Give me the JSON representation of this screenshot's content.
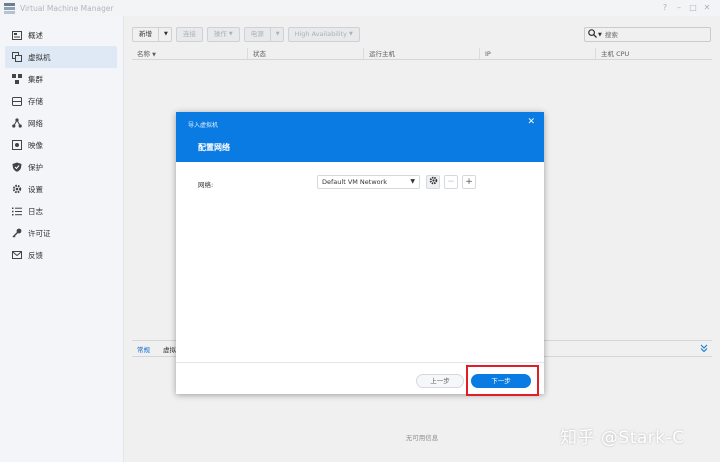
{
  "app": {
    "title": "Virtual Machine Manager"
  },
  "window_controls": [
    "?",
    "–",
    "□",
    "✕"
  ],
  "sidebar": {
    "items": [
      {
        "label": "概述",
        "icon": "overview-icon",
        "active": false
      },
      {
        "label": "虚拟机",
        "icon": "virtual-machine-icon",
        "active": true
      },
      {
        "label": "集群",
        "icon": "cluster-icon",
        "active": false
      },
      {
        "label": "存储",
        "icon": "storage-icon",
        "active": false
      },
      {
        "label": "网络",
        "icon": "network-icon",
        "active": false
      },
      {
        "label": "映像",
        "icon": "image-icon",
        "active": false
      },
      {
        "label": "保护",
        "icon": "shield-icon",
        "active": false
      },
      {
        "label": "设置",
        "icon": "gear-icon",
        "active": false
      },
      {
        "label": "日志",
        "icon": "list-icon",
        "active": false
      },
      {
        "label": "许可证",
        "icon": "key-icon",
        "active": false
      },
      {
        "label": "反馈",
        "icon": "mail-icon",
        "active": false
      }
    ]
  },
  "toolbar": {
    "new_label": "新增",
    "connect_label": "连接",
    "action_label": "操作",
    "power_label": "电源",
    "ha_label": "High Availability"
  },
  "search": {
    "placeholder": "搜索"
  },
  "table": {
    "columns": [
      "名称",
      "状态",
      "运行主机",
      "IP",
      "主机 CPU"
    ]
  },
  "bottom": {
    "tabs": [
      "常规",
      "虚拟"
    ],
    "no_info": "无可用信息"
  },
  "dialog": {
    "title": "导入虚拟机",
    "heading": "配置网络",
    "network_label": "网络:",
    "network_value": "Default VM Network",
    "prev_label": "上一步",
    "next_label": "下一步"
  },
  "watermark": "知乎 @Stark-C"
}
